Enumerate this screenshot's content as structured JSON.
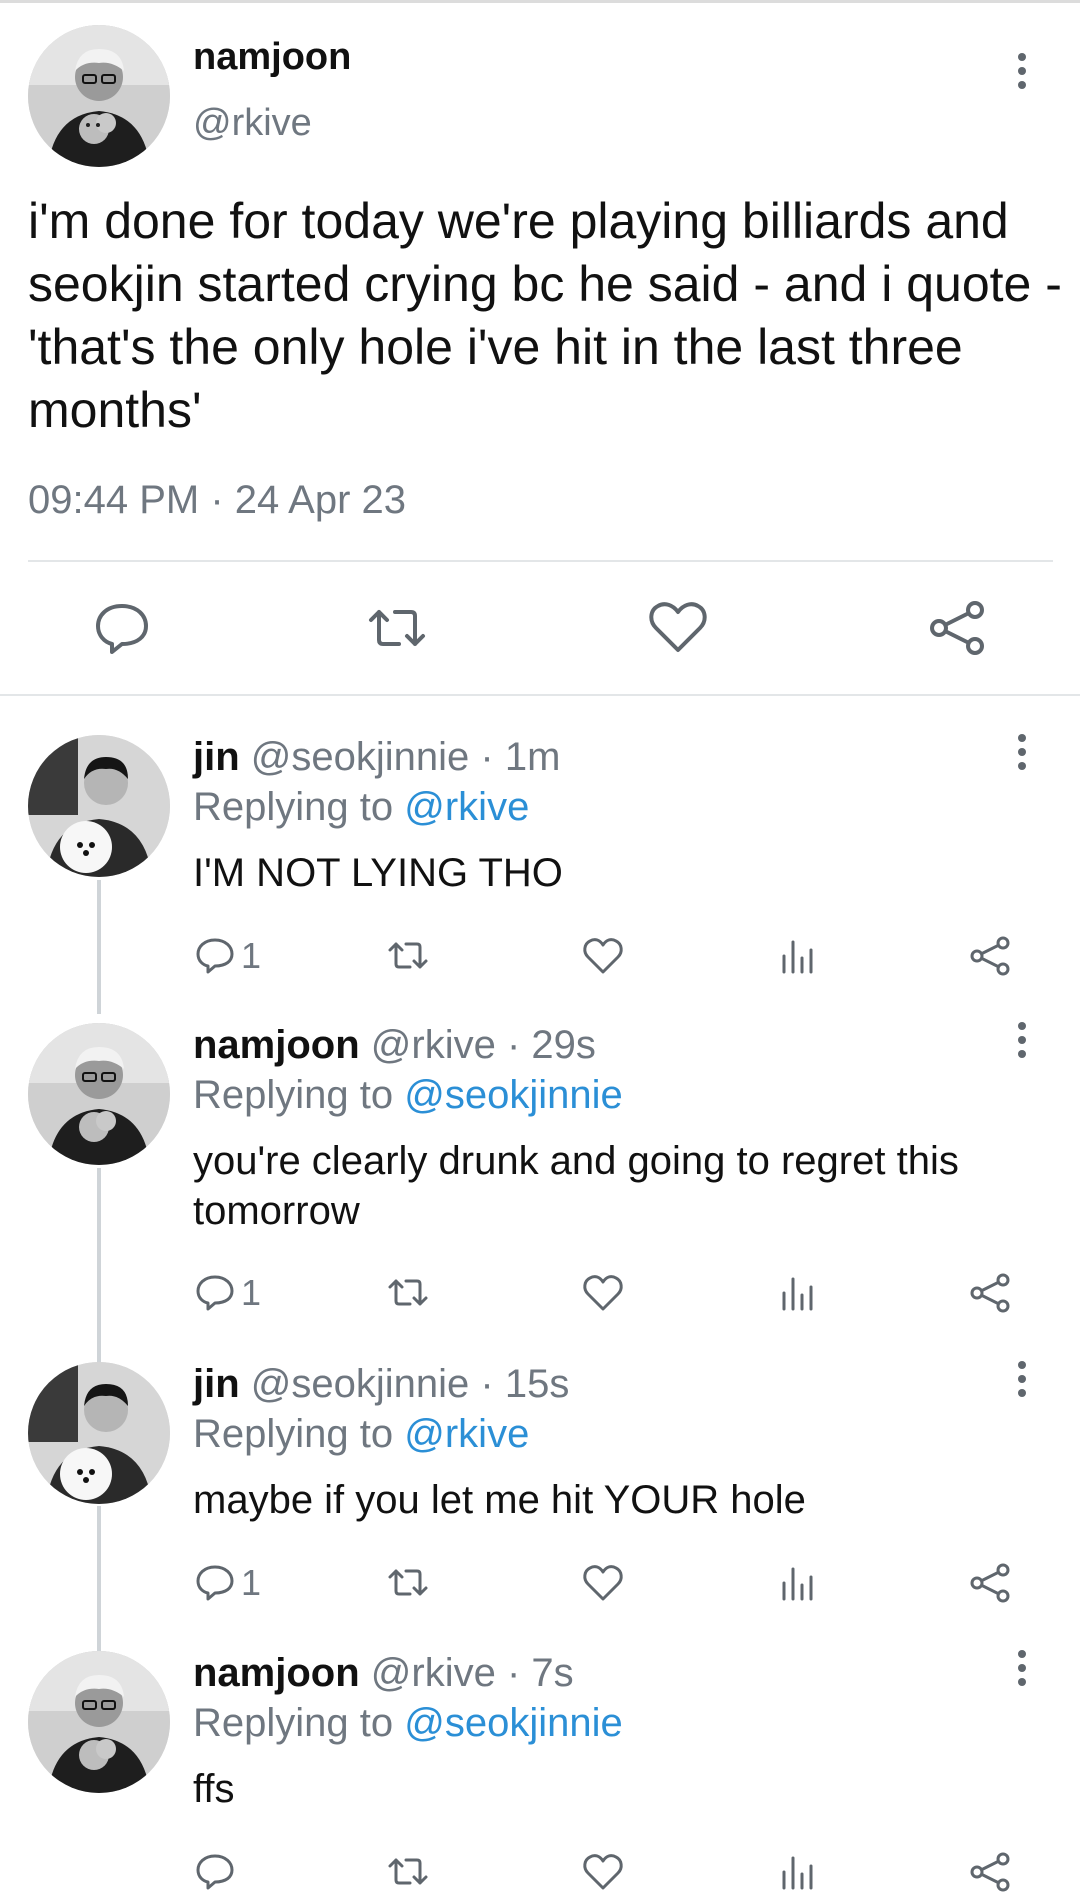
{
  "main_tweet": {
    "name": "namjoon",
    "handle": "@rkive",
    "text": "i'm done for today we're playing billiards and seokjin started crying bc he said - and i quote - 'that's the only hole i've hit in the last three months'",
    "timestamp": "09:44 PM · 24 Apr 23",
    "avatar_icon": "avatar-namjoon-with-dog",
    "action_icons": [
      "reply-icon",
      "retweet-icon",
      "like-icon",
      "share-icon"
    ]
  },
  "replies": [
    {
      "name": "jin",
      "meta": "@seokjinnie · 1m",
      "replying_prefix": "Replying to",
      "replying_to": "@rkive",
      "text": "I'M NOT LYING THO",
      "reply_count": "1",
      "avatar_icon": "avatar-jin-with-dog"
    },
    {
      "name": "namjoon",
      "meta": "@rkive · 29s",
      "replying_prefix": "Replying to",
      "replying_to": "@seokjinnie",
      "text": "you're clearly drunk and going to regret this tomorrow",
      "reply_count": "1",
      "avatar_icon": "avatar-namjoon-with-dog"
    },
    {
      "name": "jin",
      "meta": "@seokjinnie · 15s",
      "replying_prefix": "Replying to",
      "replying_to": "@rkive",
      "text": "maybe if you let me hit YOUR hole",
      "reply_count": "1",
      "avatar_icon": "avatar-jin-with-dog"
    },
    {
      "name": "namjoon",
      "meta": "@rkive · 7s",
      "replying_prefix": "Replying to",
      "replying_to": "@seokjinnie",
      "text": "ffs",
      "reply_count": "",
      "avatar_icon": "avatar-namjoon-with-dog"
    }
  ],
  "colors": {
    "text": "#111111",
    "secondary": "#6f7780",
    "mention": "#2b8fd6",
    "divider": "#e3e6e8"
  }
}
